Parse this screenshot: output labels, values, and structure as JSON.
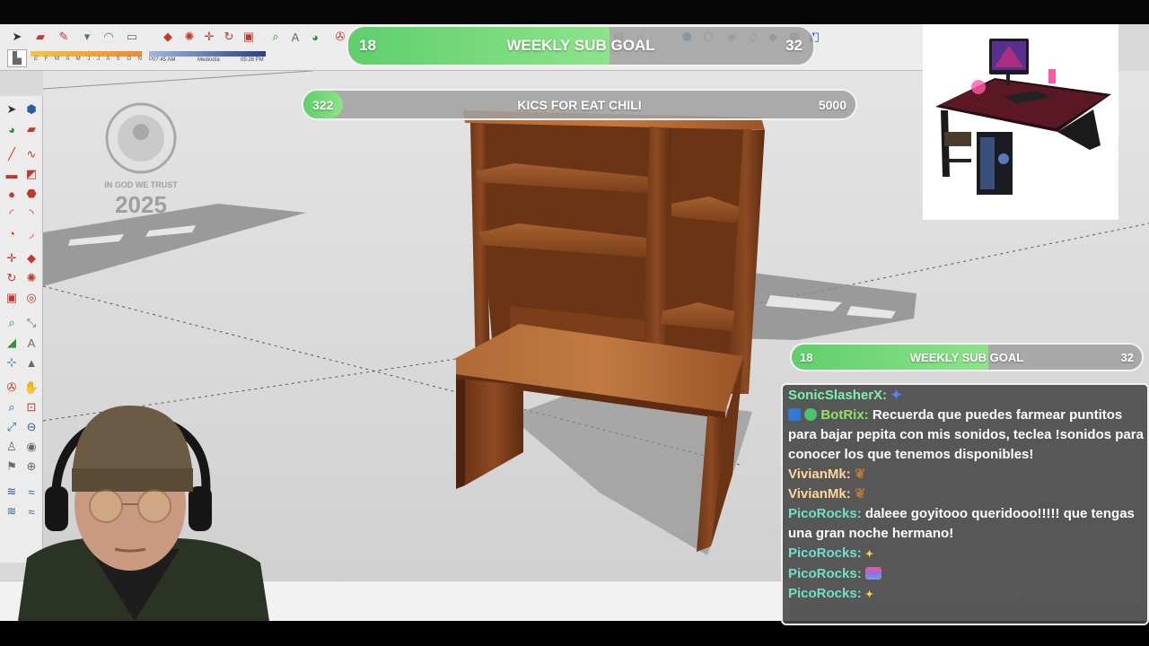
{
  "app": {
    "toolbar_time_labels": [
      "07:45 AM",
      "Mediodía",
      "05:28 PM"
    ],
    "toolbar_months": "E F M A M J J A S O N D"
  },
  "seal": {
    "line1": "IN GOD WE TRUST",
    "year": "2025"
  },
  "weekly_goal_top": {
    "current": "18",
    "title": "WEEKLY SUB GOAL",
    "target": "32",
    "progress": 0.5625
  },
  "kicks_goal": {
    "current": "322",
    "title": "KICS FOR EAT CHILI",
    "target": "5000",
    "progress": 0.0644
  },
  "weekly_goal_chat": {
    "current": "18",
    "title": "WEEKLY SUB GOAL",
    "target": "32",
    "progress": 0.5625
  },
  "chat": {
    "messages": [
      {
        "user": "SonicSlasherX:",
        "text": "",
        "color": "#7ff2a9",
        "emote": "sonic-emote"
      },
      {
        "user": "BotRix:",
        "text": "Recuerda que puedes farmear puntitos para bajar pepita con mis sonidos, teclea !sonidos para conocer los que tenemos disponibles!",
        "color": "#8fe36b",
        "emote": ""
      },
      {
        "user": "VivianMk:",
        "text": "",
        "color": "#ffd79a",
        "emote": "bear-emote"
      },
      {
        "user": "VivianMk:",
        "text": "",
        "color": "#ffd79a",
        "emote": "bear-emote"
      },
      {
        "user": "PicoRocks:",
        "text": "daleee goyitooo queridooo!!!!! que tengas una gran noche hermano!",
        "color": "#6fe0c9",
        "emote": ""
      },
      {
        "user": "PicoRocks:",
        "text": "",
        "color": "#6fe0c9",
        "emote": "sparkle-emote"
      },
      {
        "user": "PicoRocks:",
        "text": "",
        "color": "#6fe0c9",
        "emote": "rainbow-emote"
      },
      {
        "user": "PicoRocks:",
        "text": "",
        "color": "#6fe0c9",
        "emote": "sparkle-emote"
      }
    ]
  },
  "colors": {
    "goal_fill": "#5fcf6c",
    "wood": "#8a4a22",
    "chat_bg": "#464646"
  }
}
